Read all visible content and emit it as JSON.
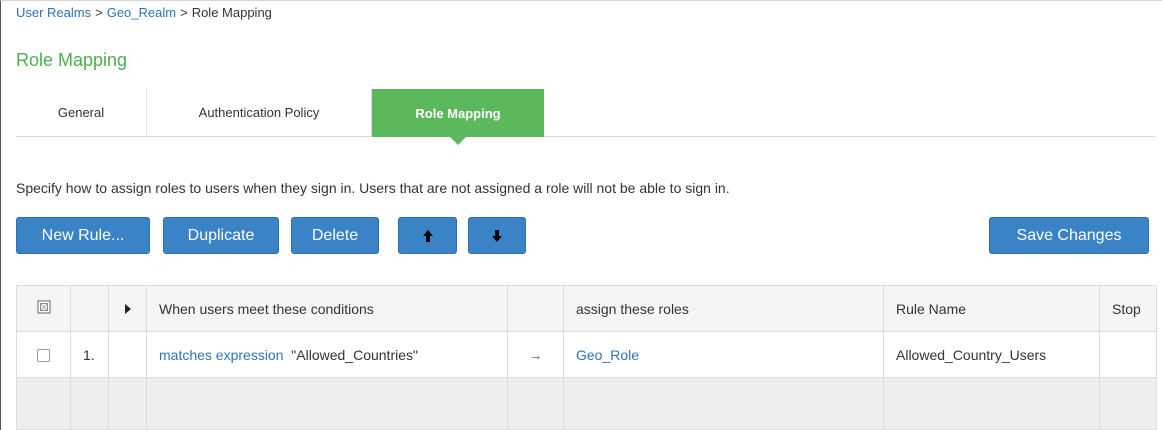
{
  "breadcrumb": {
    "items": [
      "User Realms",
      "Geo_Realm"
    ],
    "separator": ">",
    "current": "Role Mapping"
  },
  "page_title": "Role Mapping",
  "tabs": [
    {
      "label": "General"
    },
    {
      "label": "Authentication Policy"
    },
    {
      "label": "Role Mapping",
      "active": true
    }
  ],
  "description": "Specify how to assign roles to users when they sign in. Users that are not assigned a role will not be able to sign in.",
  "toolbar": {
    "new_rule": "New Rule...",
    "duplicate": "Duplicate",
    "delete": "Delete",
    "save_changes": "Save Changes",
    "move_up_icon": "arrow-up-icon",
    "move_down_icon": "arrow-down-icon"
  },
  "table": {
    "headers": {
      "conditions": "When users meet these conditions",
      "roles": "assign these roles",
      "rule_name": "Rule Name",
      "stop": "Stop"
    },
    "rows": [
      {
        "index": "1.",
        "condition_link": "matches expression",
        "condition_value": "\"Allowed_Countries\"",
        "arrow": "→",
        "role": "Geo_Role",
        "rule_name": "Allowed_Country_Users",
        "stop": ""
      }
    ]
  },
  "colors": {
    "accent_green": "#5cb85c",
    "title_green": "#4caf50",
    "button_blue": "#3a83c6",
    "link_blue": "#2e74b5"
  }
}
